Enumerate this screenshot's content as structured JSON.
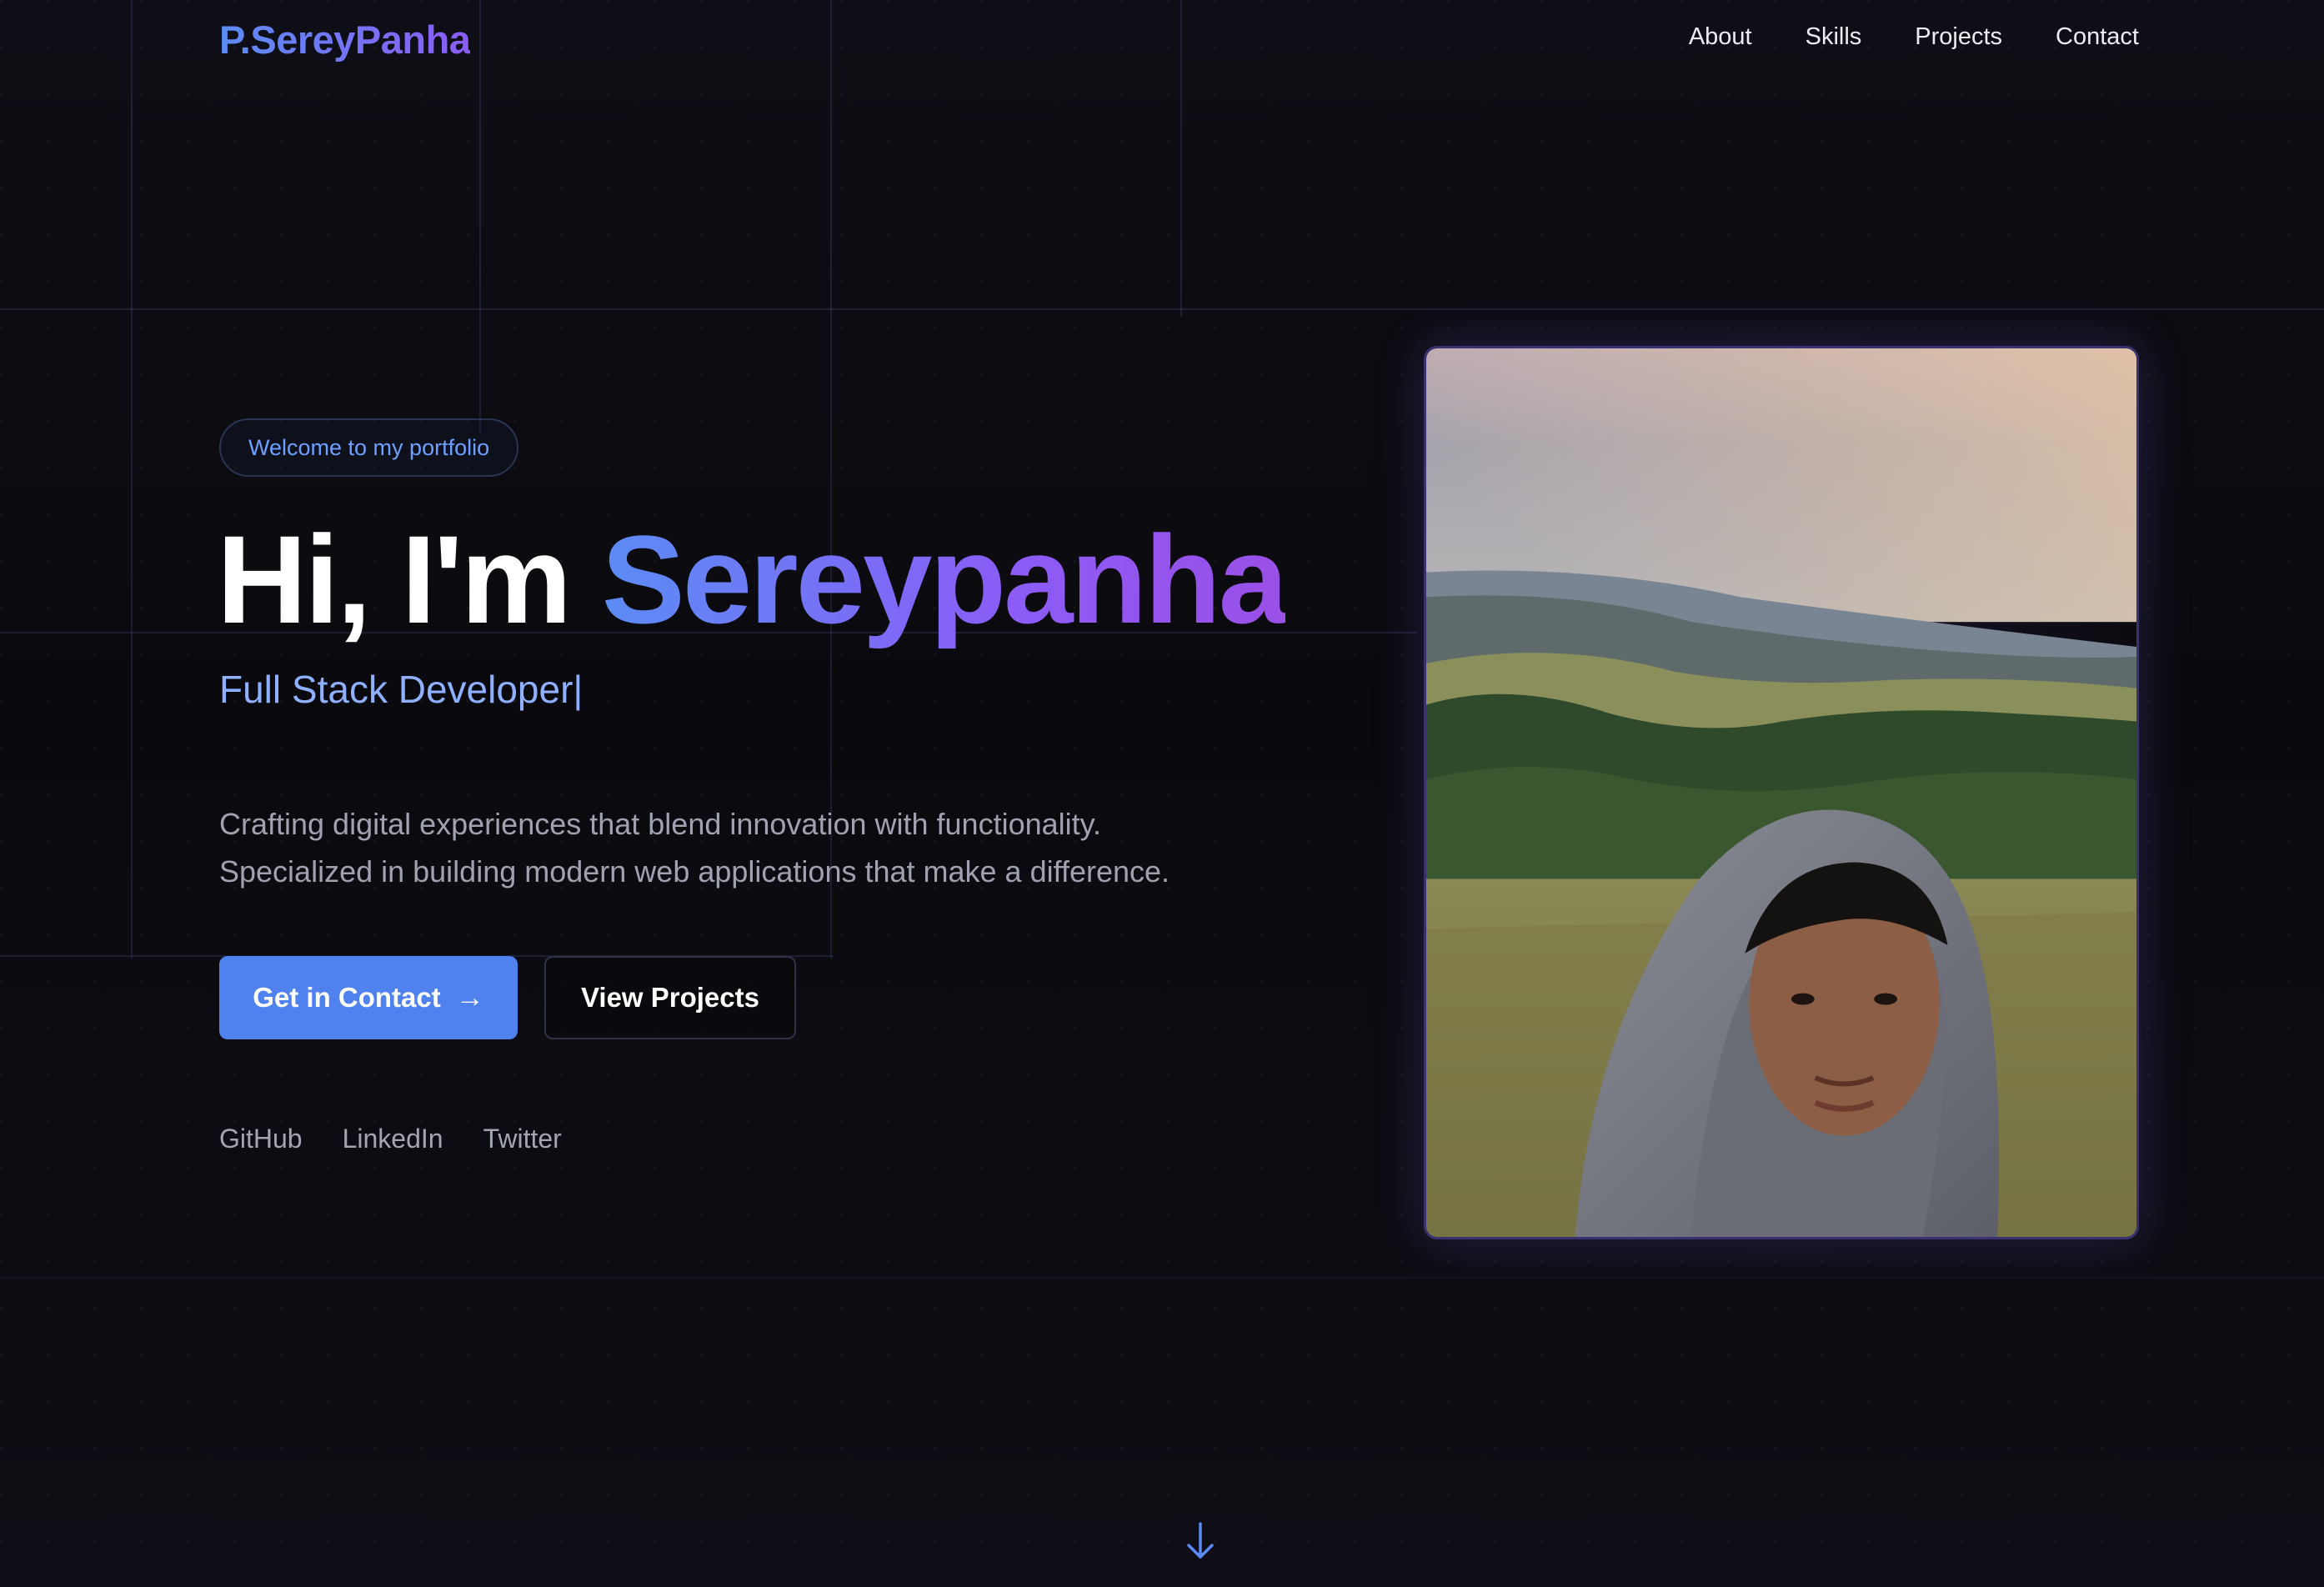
{
  "nav": {
    "logo": "P.SereyPanha",
    "links": [
      "About",
      "Skills",
      "Projects",
      "Contact"
    ]
  },
  "hero": {
    "badge": "Welcome to my portfolio",
    "greeting": "Hi, I'm ",
    "name": "Sereypanha",
    "role": "Full Stack Developer",
    "cursor": "|",
    "description_line1": "Crafting digital experiences that blend innovation with functionality.",
    "description_line2": "Specialized in building modern web applications that make a difference.",
    "primary_button": "Get in Contact",
    "primary_arrow": "→",
    "secondary_button": "View Projects",
    "socials": [
      "GitHub",
      "LinkedIn",
      "Twitter"
    ]
  },
  "colors": {
    "accent_blue": "#4f82ef",
    "accent_purple": "#8b5cf6",
    "background": "#0c0c11"
  },
  "icons": {
    "scroll": "arrow-down-icon",
    "button_arrow": "arrow-right-icon"
  }
}
